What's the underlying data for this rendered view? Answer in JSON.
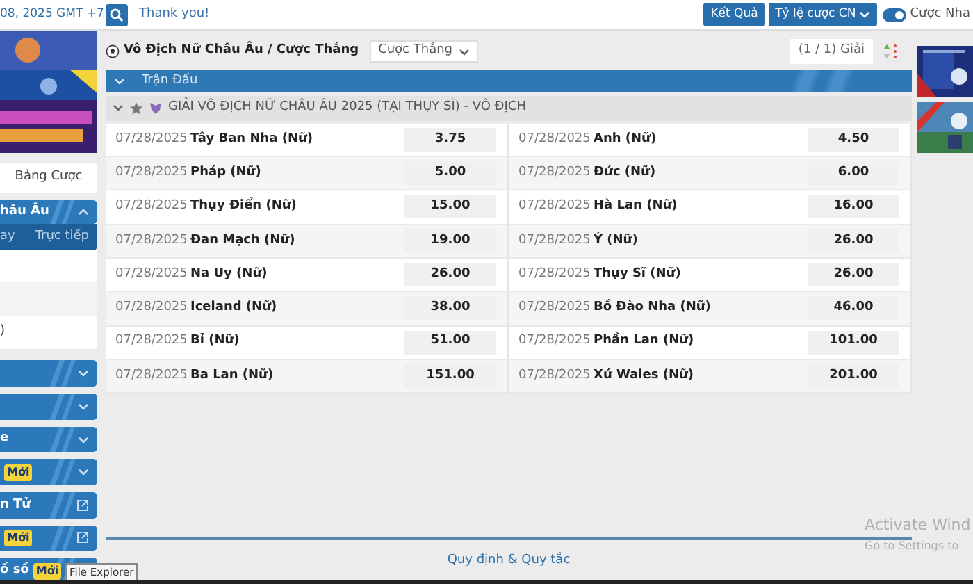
{
  "topbar": {
    "datetime": "08, 2025 GMT +7",
    "search_value": "Thank you!",
    "results_button": "Kết Quả",
    "odds_button": "Tỷ lệ cược CN",
    "toggle": {
      "label": "Cược Nha",
      "on": true
    }
  },
  "sidebar": {
    "tab": "Bảng Cược",
    "section": {
      "title": "hâu Âu",
      "expanded": true,
      "tabs": [
        {
          "label": "ay",
          "selected": false
        },
        {
          "label": "Trực tiếp",
          "selected": false
        }
      ]
    },
    "list": [
      {
        "kind": "blank"
      },
      {
        "kind": "blank"
      },
      {
        "kind": "text",
        "text": ")"
      }
    ],
    "items": [
      {
        "kind": "chevron"
      },
      {
        "kind": "chevron"
      },
      {
        "kind": "chevron",
        "text": "e"
      },
      {
        "kind": "chevron",
        "badge": "Mới"
      },
      {
        "kind": "external",
        "text": "n Tử"
      },
      {
        "kind": "external",
        "badge": "Mới"
      },
      {
        "kind": "plain",
        "text": "ố số",
        "badge": "Mới"
      }
    ],
    "tooltip": "File Explorer"
  },
  "main": {
    "breadcrumb": "Vô Địch Nữ Châu Âu / Cược Thắng",
    "bet_type": "Cược Thắng",
    "league_count": "(1 / 1) Giải",
    "section_title": "Trận Đấu",
    "league": {
      "name": "GIẢI VÔ ĐỊCH NỮ CHÂU ÂU 2025 (TẠI THỤY SĨ) - VÔ ĐỊCH",
      "favorite": false,
      "expanded": true
    },
    "rows": [
      [
        {
          "date": "07/28/2025",
          "team": "Tây Ban Nha (Nữ)",
          "odds": "3.75"
        },
        {
          "date": "07/28/2025",
          "team": "Anh (Nữ)",
          "odds": "4.50"
        }
      ],
      [
        {
          "date": "07/28/2025",
          "team": "Pháp (Nữ)",
          "odds": "5.00"
        },
        {
          "date": "07/28/2025",
          "team": "Đức (Nữ)",
          "odds": "6.00"
        }
      ],
      [
        {
          "date": "07/28/2025",
          "team": "Thụy Điển (Nữ)",
          "odds": "15.00"
        },
        {
          "date": "07/28/2025",
          "team": "Hà Lan (Nữ)",
          "odds": "16.00"
        }
      ],
      [
        {
          "date": "07/28/2025",
          "team": "Đan Mạch (Nữ)",
          "odds": "19.00"
        },
        {
          "date": "07/28/2025",
          "team": "Ý (Nữ)",
          "odds": "26.00"
        }
      ],
      [
        {
          "date": "07/28/2025",
          "team": "Na Uy (Nữ)",
          "odds": "26.00"
        },
        {
          "date": "07/28/2025",
          "team": "Thụy Sĩ (Nữ)",
          "odds": "26.00"
        }
      ],
      [
        {
          "date": "07/28/2025",
          "team": "Iceland (Nữ)",
          "odds": "38.00"
        },
        {
          "date": "07/28/2025",
          "team": "Bồ Đào Nha (Nữ)",
          "odds": "46.00"
        }
      ],
      [
        {
          "date": "07/28/2025",
          "team": "Bỉ (Nữ)",
          "odds": "51.00"
        },
        {
          "date": "07/28/2025",
          "team": "Phần Lan (Nữ)",
          "odds": "101.00"
        }
      ],
      [
        {
          "date": "07/28/2025",
          "team": "Ba Lan (Nữ)",
          "odds": "151.00"
        },
        {
          "date": "07/28/2025",
          "team": "Xứ Wales (Nữ)",
          "odds": "201.00"
        }
      ]
    ],
    "footer_link": "Quy định & Quy tắc"
  },
  "os_watermark": {
    "title": "Activate Wind",
    "subtitle": "Go to Settings to"
  }
}
